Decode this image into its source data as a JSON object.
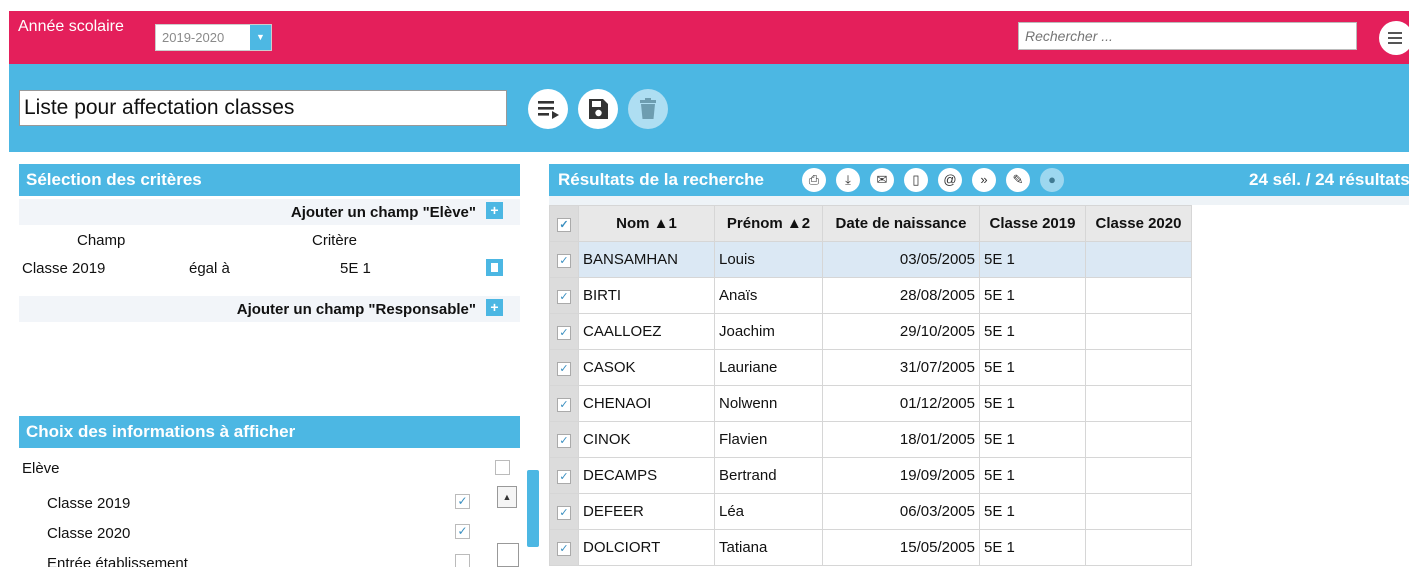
{
  "topbar": {
    "year_label": "Année scolaire",
    "year_value": "2019-2020",
    "search_placeholder": "Rechercher ..."
  },
  "toolbar": {
    "list_name": "Liste pour affectation classes"
  },
  "criteria": {
    "heading": "Sélection des critères",
    "add_student_field": "Ajouter un champ \"Elève\"",
    "col_field": "Champ",
    "col_criterion": "Critère",
    "row": {
      "field": "Classe 2019",
      "operator": "égal à",
      "value": "5E 1"
    },
    "add_responsible_field": "Ajouter un champ \"Responsable\""
  },
  "display": {
    "heading": "Choix des informations à afficher",
    "group_label": "Elève",
    "items": [
      {
        "label": "Classe 2019",
        "checked": true
      },
      {
        "label": "Classe 2020",
        "checked": true
      },
      {
        "label": "Entrée établissement",
        "checked": false
      }
    ]
  },
  "results": {
    "heading": "Résultats de la recherche",
    "count": "24 sél. / 24 résultats",
    "columns": [
      "Nom ▲1",
      "Prénom ▲2",
      "Date de naissance",
      "Classe 2019",
      "Classe 2020"
    ],
    "rows": [
      {
        "nom": "BANSAMHAN",
        "prenom": "Louis",
        "date": "03/05/2005",
        "c2019": "5E 1",
        "c2020": ""
      },
      {
        "nom": "BIRTI",
        "prenom": "Anaïs",
        "date": "28/08/2005",
        "c2019": "5E 1",
        "c2020": ""
      },
      {
        "nom": "CAALLOEZ",
        "prenom": "Joachim",
        "date": "29/10/2005",
        "c2019": "5E 1",
        "c2020": ""
      },
      {
        "nom": "CASOK",
        "prenom": "Lauriane",
        "date": "31/07/2005",
        "c2019": "5E 1",
        "c2020": ""
      },
      {
        "nom": "CHENAOI",
        "prenom": "Nolwenn",
        "date": "01/12/2005",
        "c2019": "5E 1",
        "c2020": ""
      },
      {
        "nom": "CINOK",
        "prenom": "Flavien",
        "date": "18/01/2005",
        "c2019": "5E 1",
        "c2020": ""
      },
      {
        "nom": "DECAMPS",
        "prenom": "Bertrand",
        "date": "19/09/2005",
        "c2019": "5E 1",
        "c2020": ""
      },
      {
        "nom": "DEFEER",
        "prenom": "Léa",
        "date": "06/03/2005",
        "c2019": "5E 1",
        "c2020": ""
      },
      {
        "nom": "DOLCIORT",
        "prenom": "Tatiana",
        "date": "15/05/2005",
        "c2019": "5E 1",
        "c2020": ""
      }
    ]
  },
  "icons": {
    "toolbar": [
      "list-run-icon",
      "save-icon",
      "trash-icon"
    ],
    "results": [
      "print-icon",
      "download-icon",
      "mail-icon",
      "mobile-icon",
      "at-icon",
      "fast-icon",
      "sign-icon",
      "person-icon"
    ]
  },
  "colors": {
    "accent_pink": "#e41f5b",
    "accent_blue": "#4cb7e3"
  }
}
